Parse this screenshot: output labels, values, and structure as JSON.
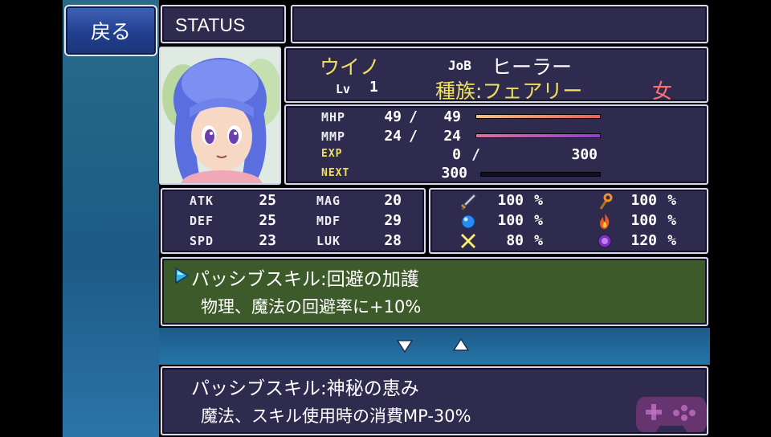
{
  "nav": {
    "back_label": "戻る",
    "title": "STATUS"
  },
  "character": {
    "name": "ウイノ",
    "job_label": "JoB",
    "job": "ヒーラー",
    "level_label": "Lv",
    "level": "1",
    "race": "種族:フェアリー",
    "gender": "女"
  },
  "vitals": {
    "mhp_label": "MHP",
    "mhp_cur": "49",
    "mhp_sep": "/",
    "mhp_max": "49",
    "mmp_label": "MMP",
    "mmp_cur": "24",
    "mmp_sep": "/",
    "mmp_max": "24",
    "exp_label": "EXP",
    "exp_cur": "0",
    "exp_sep": "/",
    "exp_max": "300",
    "next_label": "NEXT",
    "next_val": "300",
    "hp_fill": 1.0,
    "mp_fill": 1.0,
    "next_fill": 0.0
  },
  "stats": [
    {
      "label": "ATK",
      "value": "25"
    },
    {
      "label": "DEF",
      "value": "25"
    },
    {
      "label": "SPD",
      "value": "23"
    },
    {
      "label": "MAG",
      "value": "20"
    },
    {
      "label": "MDF",
      "value": "29"
    },
    {
      "label": "LUK",
      "value": "28"
    }
  ],
  "resistances": [
    {
      "icon": "sword-icon",
      "value": "100",
      "unit": "%"
    },
    {
      "icon": "water-orb-icon",
      "value": "100",
      "unit": "%"
    },
    {
      "icon": "lightning-icon",
      "value": "80",
      "unit": "%"
    },
    {
      "icon": "staff-icon",
      "value": "100",
      "unit": "%"
    },
    {
      "icon": "fire-icon",
      "value": "100",
      "unit": "%"
    },
    {
      "icon": "dark-orb-icon",
      "value": "120",
      "unit": "%"
    }
  ],
  "skills": [
    {
      "name": "パッシブスキル:回避の加護",
      "desc": "物理、魔法の回避率に+10%",
      "selected": true
    },
    {
      "name": "パッシブスキル:神秘の恵み",
      "desc": "魔法、スキル使用時の消費MP-30%",
      "selected": false
    }
  ],
  "colors": {
    "panel_bg": "#2e2b4f",
    "selected_bg": "#3d5a2a",
    "name": "#f0e060",
    "race": "#f0e060",
    "gender": "#ff7070",
    "hp_bar": "#e8605a",
    "mp_bar": "#b050d0"
  }
}
